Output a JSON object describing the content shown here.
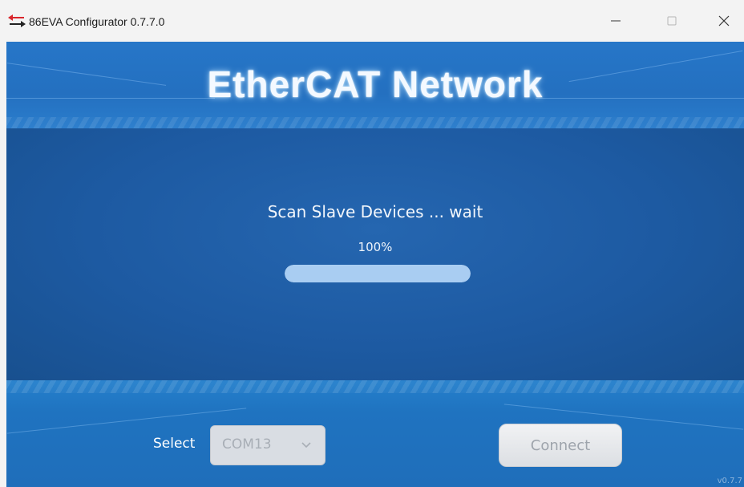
{
  "window": {
    "title": "86EVA Configurator 0.7.7.0",
    "controls": {
      "minimize_icon": "minimize-icon",
      "maximize_icon": "maximize-icon",
      "close_icon": "close-icon"
    }
  },
  "header": {
    "title": "EtherCAT Network"
  },
  "scan": {
    "status_text": "Scan Slave Devices ... wait",
    "percent_text": "100%",
    "progress": 1.0
  },
  "footer": {
    "select_label": "Select",
    "port_select": {
      "value": "COM13",
      "icon": "chevron-down-icon"
    },
    "connect_label": "Connect",
    "version": "v0.7.7"
  },
  "colors": {
    "accent": "#1f6eba",
    "progress_fill": "#a9cdf2",
    "title_glow": "#bee6ff"
  }
}
